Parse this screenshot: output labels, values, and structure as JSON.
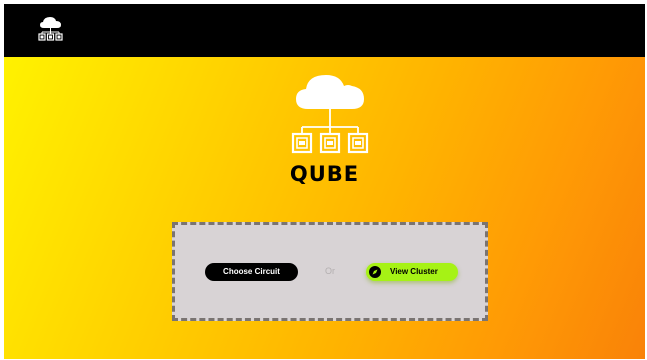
{
  "app": {
    "title": "QUBE",
    "logo_icon": "cloud-network-icon"
  },
  "topbar": {
    "logo_icon": "cloud-network-icon"
  },
  "actions": {
    "choose_circuit_label": "Choose Circuit",
    "separator_text": "Or",
    "view_cluster_label": "View Cluster",
    "view_cluster_icon": "compass-icon"
  },
  "colors": {
    "topbar": "#000000",
    "gradient_start": "#fff200",
    "gradient_end": "#f98208",
    "panel": "#d8d3d5",
    "panel_border": "#7a7472",
    "accent": "#a6f215"
  }
}
